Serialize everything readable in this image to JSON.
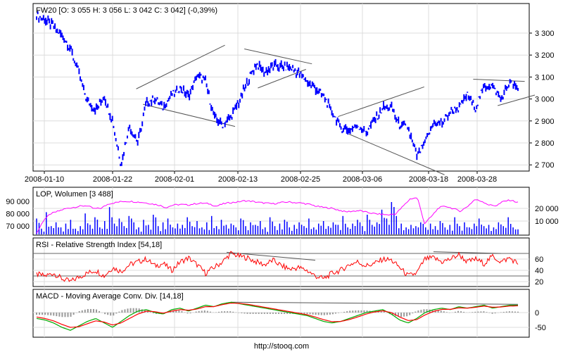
{
  "chart_data": [
    {
      "type": "line",
      "title": "FW20 [O: 3 055  H: 3 056  L: 3 042  C: 3 042] (-0,39%)",
      "x_tick_labels": [
        "2008-01-10",
        "2008-01-22",
        "2008-02-01",
        "2008-02-13",
        "2008-02-25",
        "2008-03-06",
        "2008-03-18",
        "2008-03-28"
      ],
      "y_tick_labels": [
        "3 300",
        "3 200",
        "3 100",
        "3 000",
        "2 900",
        "2 800",
        "2 700"
      ],
      "y_ticks": [
        3300,
        3200,
        3100,
        3000,
        2900,
        2800,
        2700
      ],
      "ylim": [
        2670,
        3430
      ],
      "grid": true,
      "series": [
        {
          "name": "FW20",
          "color": "#0000ff",
          "values": [
            3380,
            3360,
            3330,
            3290,
            3230,
            3120,
            2990,
            2950,
            3010,
            2900,
            2700,
            2880,
            2800,
            2980,
            3000,
            2960,
            3020,
            3050,
            3010,
            3110,
            3080,
            2920,
            2880,
            2920,
            2990,
            3080,
            3160,
            3120,
            3150,
            3150,
            3140,
            3120,
            3080,
            3050,
            3010,
            2940,
            2870,
            2860,
            2880,
            2850,
            2900,
            2960,
            2960,
            2880,
            2870,
            2740,
            2800,
            2890,
            2890,
            2940,
            2960,
            3020,
            2960,
            3060,
            3060,
            3000,
            3070,
            3042
          ]
        }
      ],
      "trendlines": [
        [
          11.8,
          3046,
          22.3,
          3245
        ],
        [
          12.6,
          2976,
          23.5,
          2875
        ],
        [
          24.6,
          3228,
          32.6,
          3160
        ],
        [
          26.2,
          3050,
          31.9,
          3135
        ],
        [
          35.7,
          2920,
          45.9,
          3055
        ],
        [
          37,
          2840,
          48.3,
          2655
        ],
        [
          51.7,
          3090,
          57.8,
          3080
        ],
        [
          54.6,
          2970,
          59,
          3018
        ]
      ]
    },
    {
      "type": "bar",
      "title": "LOP, Wolumen [3 488]",
      "left_y_tick_labels": [
        "90 000",
        "80 000",
        "70 000"
      ],
      "left_y_ticks": [
        90000,
        80000,
        70000
      ],
      "right_y_tick_labels": [
        "20 000",
        "10 000"
      ],
      "right_y_ticks": [
        20000,
        10000
      ],
      "series": [
        {
          "name": "Wolumen",
          "color": "#0000ff",
          "values": [
            12000,
            4000,
            17000,
            6000,
            9000,
            5000,
            8000,
            11000,
            4000,
            6000,
            16000,
            7000,
            13000,
            5000,
            10000,
            21000,
            8000,
            12000,
            6000,
            14000,
            9000,
            5000,
            11000,
            7000,
            15000,
            6000,
            9000,
            12000,
            5000,
            8000,
            7000,
            13000,
            6000,
            10000,
            5000,
            9000,
            14000,
            6000,
            11000,
            7000,
            8000,
            5000,
            12000,
            6000,
            9000,
            7000,
            10000,
            5000,
            13000,
            6000,
            8000,
            11000,
            5000,
            7000,
            9000,
            6000,
            12000,
            5000,
            8000,
            10000,
            6000,
            9000,
            7000,
            14000,
            5000,
            8000,
            11000,
            6000,
            15000,
            7000,
            9000,
            19000,
            12000,
            25000,
            14000,
            8000,
            5000,
            7000,
            6000,
            9000,
            5000,
            8000,
            6000,
            10000,
            5000,
            7000,
            13000,
            6000,
            9000,
            5000,
            8000,
            12000,
            6000,
            7000,
            5000,
            9000,
            6000,
            13000,
            5000,
            3488
          ]
        },
        {
          "name": "LOP",
          "color": "#ff00ff",
          "values": [
            64000,
            75000,
            80000,
            82000,
            84000,
            85000,
            86000,
            86500,
            84000,
            84500,
            88000,
            89000,
            90000,
            90000,
            89500,
            89000,
            88000,
            87000,
            85000,
            87000,
            87500,
            87000,
            88000,
            88500,
            88000,
            86000,
            88000,
            89000,
            89500,
            90500,
            90000,
            89000,
            88500,
            88000,
            89000,
            89500,
            89000,
            88500,
            87500,
            86000,
            85000,
            84500,
            83000,
            81500,
            82000,
            82500,
            81000,
            80000,
            79500,
            79000,
            80000,
            86000,
            92000,
            93000,
            72000,
            78000,
            85000,
            86000,
            84000,
            82000,
            86000,
            91500,
            90000,
            87000,
            86500,
            90000,
            91000,
            89000
          ]
        }
      ]
    },
    {
      "type": "line",
      "title": "RSI - Relative Strength Index [54,18]",
      "y_tick_labels": [
        "60",
        "40",
        "20"
      ],
      "y_ticks": [
        60,
        40,
        20
      ],
      "reference_lines": [
        70,
        30
      ],
      "series": [
        {
          "name": "RSI",
          "color": "#ff0000",
          "values": [
            33,
            30,
            35,
            25,
            20,
            28,
            35,
            40,
            30,
            45,
            38,
            50,
            55,
            60,
            48,
            52,
            40,
            55,
            62,
            50,
            35,
            45,
            55,
            70,
            65,
            62,
            55,
            50,
            58,
            48,
            42,
            45,
            40,
            30,
            25,
            35,
            40,
            50,
            55,
            48,
            52,
            60,
            58,
            45,
            30,
            35,
            60,
            62,
            55,
            60,
            68,
            55,
            60,
            52,
            65,
            55,
            62,
            52
          ]
        }
      ],
      "trendlines": [
        [
          22.5,
          72,
          33,
          58
        ],
        [
          47,
          73,
          55,
          70
        ]
      ]
    },
    {
      "type": "line",
      "title": "MACD - Moving Average Conv. Div. [14,18]",
      "y_tick_labels": [
        "0",
        "-50"
      ],
      "y_ticks": [
        0,
        -50
      ],
      "series": [
        {
          "name": "MACD",
          "color": "#00aa00",
          "values": [
            -20,
            -25,
            -35,
            -50,
            -60,
            -45,
            -30,
            -20,
            -35,
            -50,
            -30,
            -10,
            5,
            10,
            0,
            -5,
            10,
            15,
            5,
            15,
            25,
            20,
            30,
            35,
            30,
            25,
            20,
            15,
            10,
            5,
            0,
            -5,
            -10,
            -20,
            -30,
            -35,
            -30,
            -20,
            -10,
            0,
            5,
            10,
            -5,
            -25,
            -35,
            -20,
            0,
            10,
            15,
            10,
            20,
            15,
            20,
            25,
            15,
            20,
            25,
            25
          ]
        },
        {
          "name": "Signal",
          "color": "#ff0000",
          "values": [
            -15,
            -20,
            -28,
            -40,
            -50,
            -48,
            -38,
            -28,
            -32,
            -42,
            -35,
            -20,
            -5,
            5,
            3,
            -2,
            5,
            10,
            8,
            12,
            20,
            20,
            27,
            32,
            31,
            28,
            23,
            18,
            13,
            8,
            3,
            -2,
            -7,
            -15,
            -24,
            -31,
            -30,
            -24,
            -15,
            -5,
            2,
            6,
            0,
            -15,
            -27,
            -24,
            -8,
            4,
            11,
            11,
            16,
            15,
            18,
            22,
            18,
            19,
            22,
            23
          ]
        }
      ],
      "trendlines": [
        [
          23,
          35,
          57,
          28
        ]
      ]
    }
  ],
  "footer": "http://stooq.com"
}
